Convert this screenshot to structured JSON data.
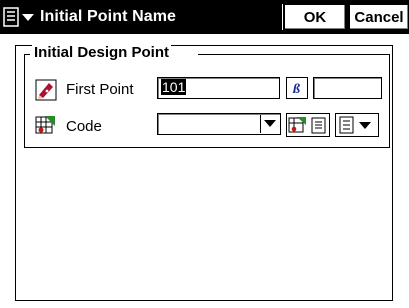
{
  "window": {
    "title": "Initial Point Name",
    "ok_label": "OK",
    "cancel_label": "Cancel"
  },
  "group": {
    "title": "Initial Design Point"
  },
  "first_point": {
    "label": "First Point",
    "value": "101",
    "extra_value": ""
  },
  "code": {
    "label": "Code",
    "value": ""
  },
  "icons": {
    "menu": "menu-list-icon",
    "first_point": "point-pencil-icon",
    "code": "code-list-icon",
    "settings": "settings-icon",
    "list": "code-list-button-icon"
  }
}
